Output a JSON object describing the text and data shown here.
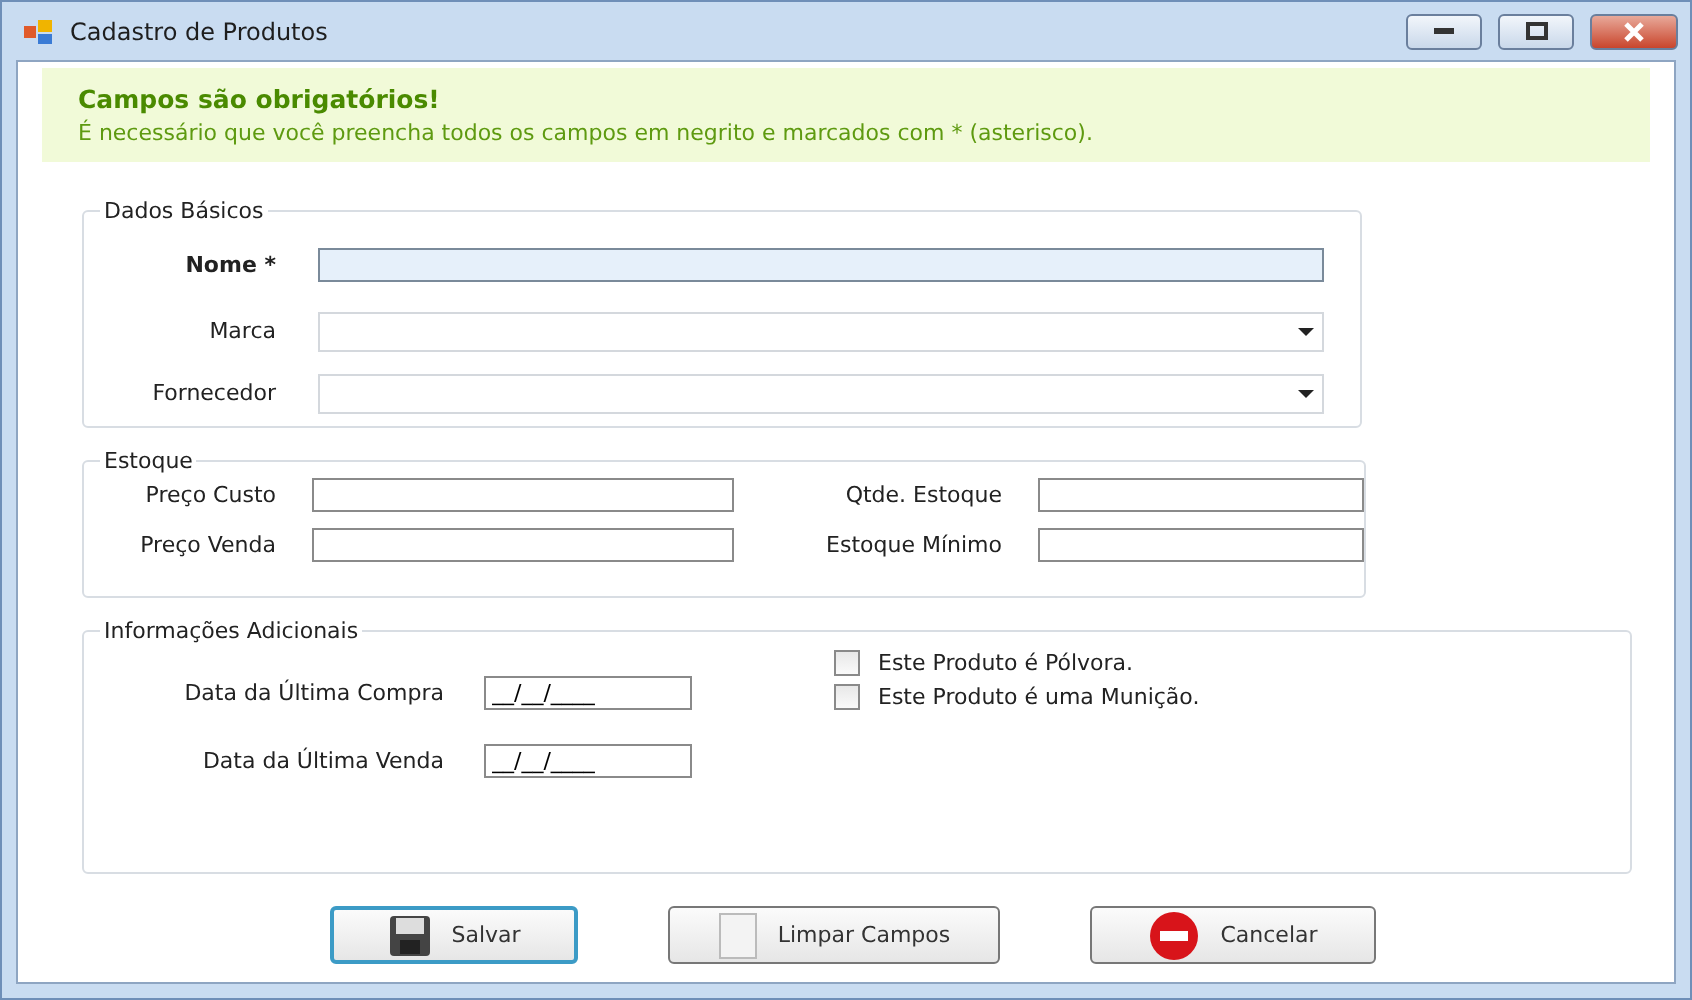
{
  "window": {
    "title": "Cadastro de Produtos"
  },
  "banner": {
    "title": "Campos são obrigatórios!",
    "message": "É necessário que você preencha todos os campos em negrito e marcados com * (asterisco)."
  },
  "basic": {
    "title": "Dados Básicos",
    "fields": [
      {
        "label": "Nome *",
        "kind": "text",
        "focused": true
      },
      {
        "label": "Marca",
        "kind": "dropdown",
        "focused": false
      },
      {
        "label": "Fornecedor",
        "kind": "dropdown",
        "focused": false
      }
    ]
  },
  "stock": {
    "title": "Estoque",
    "fields": [
      {
        "label": "Preço Custo"
      },
      {
        "label": "Qtde. Estoque"
      },
      {
        "label": "Preço Venda"
      },
      {
        "label": "Estoque Mínimo"
      }
    ]
  },
  "extra": {
    "title": "Informações Adicionais",
    "dates": [
      {
        "label": "Data da Última Compra",
        "value": "__/__/____"
      },
      {
        "label": "Data da Última Venda",
        "value": "__/__/____"
      }
    ],
    "checks": [
      {
        "label": "Este Produto é Pólvora.",
        "checked": false
      },
      {
        "label": "Este Produto é uma Munição.",
        "checked": false
      }
    ]
  },
  "buttons": [
    {
      "label": "Salvar",
      "kind": "save",
      "default": true
    },
    {
      "label": "Limpar Campos",
      "kind": "clear",
      "default": false
    },
    {
      "label": "Cancelar",
      "kind": "cancel",
      "default": false
    }
  ]
}
